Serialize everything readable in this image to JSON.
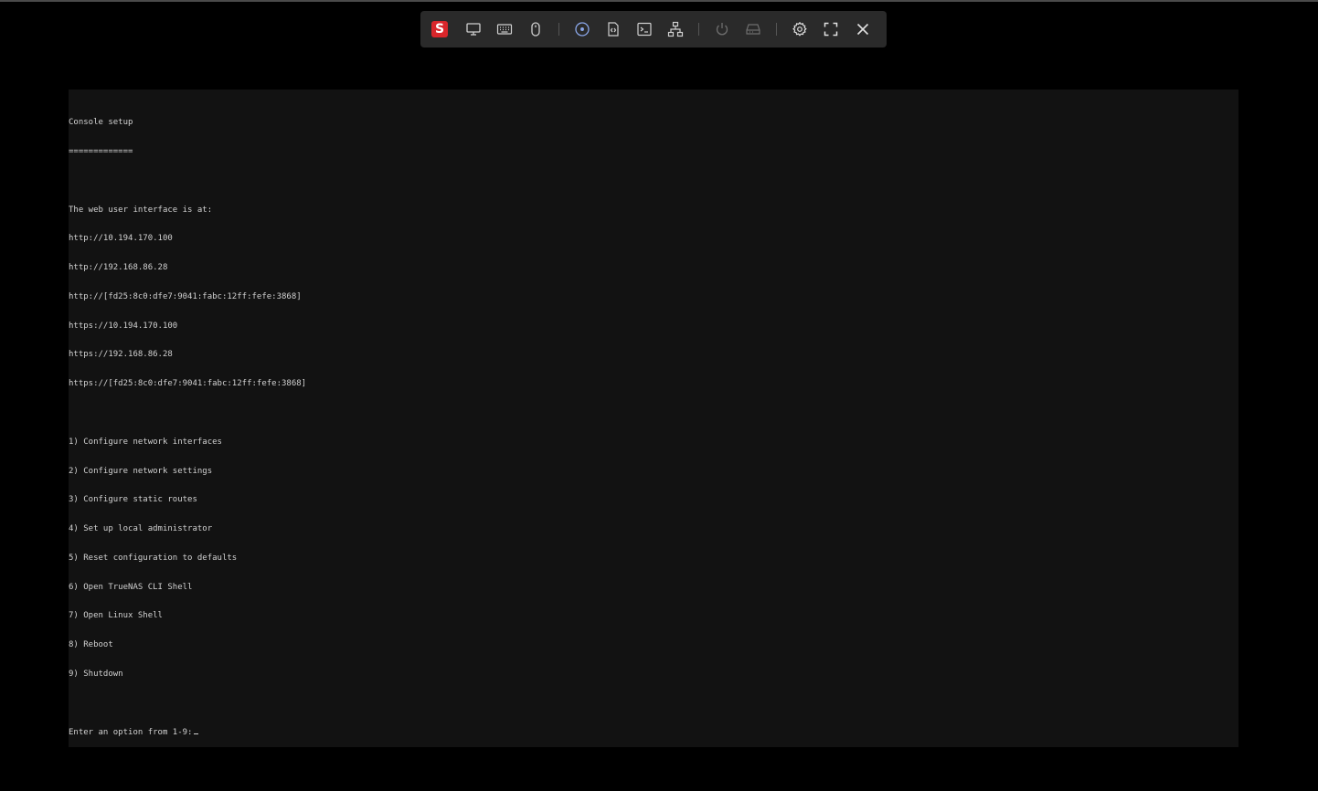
{
  "toolbar": {
    "logo_letter": "S",
    "accent": "#d9262b",
    "buttons": [
      {
        "icon": "display-icon"
      },
      {
        "icon": "keyboard-icon"
      },
      {
        "icon": "mouse-icon"
      },
      {
        "icon": "disc-icon"
      },
      {
        "icon": "file-code-icon"
      },
      {
        "icon": "terminal-icon"
      },
      {
        "icon": "network-icon"
      },
      {
        "icon": "power-icon"
      },
      {
        "icon": "drive-icon"
      },
      {
        "icon": "gear-icon"
      },
      {
        "icon": "fullscreen-icon"
      },
      {
        "icon": "close-icon"
      }
    ]
  },
  "console": {
    "title": "Console setup",
    "underline": "=============",
    "web_ui_heading": "The web user interface is at:",
    "urls": [
      "http://10.194.170.100",
      "http://192.168.86.28",
      "http://[fd25:8c0:dfe7:9041:fabc:12ff:fefe:3868]",
      "https://10.194.170.100",
      "https://192.168.86.28",
      "https://[fd25:8c0:dfe7:9041:fabc:12ff:fefe:3868]"
    ],
    "menu": [
      "1) Configure network interfaces",
      "2) Configure network settings",
      "3) Configure static routes",
      "4) Set up local administrator",
      "5) Reset configuration to defaults",
      "6) Open TrueNAS CLI Shell",
      "7) Open Linux Shell",
      "8) Reboot",
      "9) Shutdown"
    ],
    "prompt": "Enter an option from 1-9:"
  }
}
